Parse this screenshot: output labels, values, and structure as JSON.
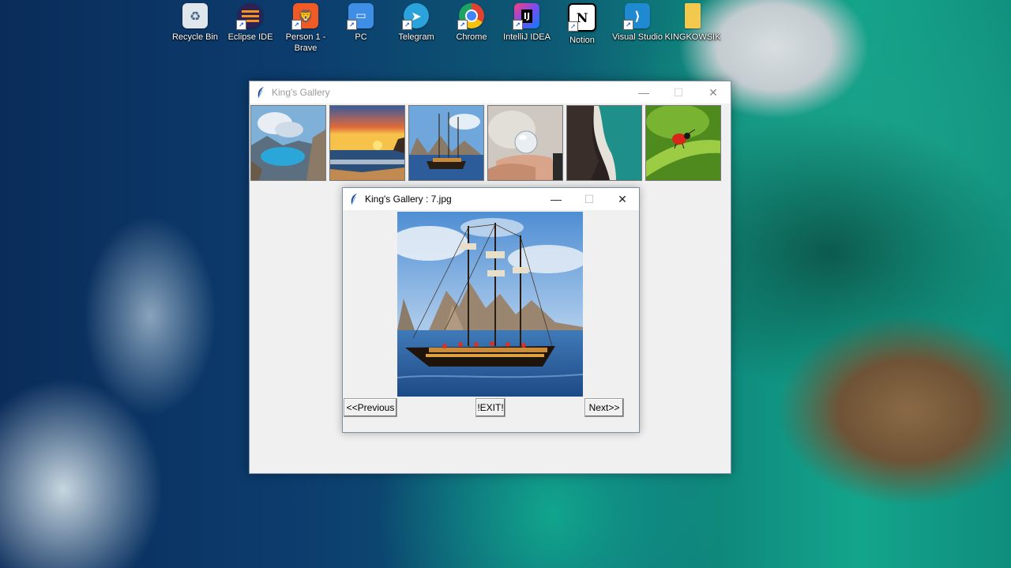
{
  "desktop": {
    "icons": [
      {
        "label": "Recycle Bin",
        "icon": "recycle-bin-icon",
        "color": "#d9e2ea"
      },
      {
        "label": "Eclipse IDE",
        "icon": "eclipse-icon",
        "color": "#3b2e74"
      },
      {
        "label": "Person 1 -\nBrave",
        "icon": "brave-icon",
        "color": "#f15a24"
      },
      {
        "label": "PC",
        "icon": "pc-icon",
        "color": "#3f8ee6"
      },
      {
        "label": "Telegram",
        "icon": "telegram-icon",
        "color": "#2aa3dd"
      },
      {
        "label": "Chrome",
        "icon": "chrome-icon",
        "color": "#e3412f"
      },
      {
        "label": "IntelliJ IDEA",
        "icon": "intellij-icon",
        "color": "#1e1e2e"
      },
      {
        "label": "Notion",
        "icon": "notion-icon",
        "color": "#ffffff"
      },
      {
        "label": "Visual Studio",
        "icon": "vscode-icon",
        "color": "#1f8ad2"
      },
      {
        "label": "KINGKOWSIK",
        "icon": "folder-icon",
        "color": "#f2c94c"
      }
    ]
  },
  "main_window": {
    "title": "King's Gallery",
    "controls": {
      "minimize": "—",
      "maximize": "☐",
      "close": "✕"
    },
    "thumbnails": [
      {
        "name": "mountain-lake-thumbnail"
      },
      {
        "name": "sunset-beach-thumbnail"
      },
      {
        "name": "pirate-ship-thumbnail"
      },
      {
        "name": "crystal-ball-hand-thumbnail"
      },
      {
        "name": "aerial-coast-thumbnail"
      },
      {
        "name": "ladybug-leaf-thumbnail"
      }
    ]
  },
  "child_window": {
    "title": "King's Gallery : 7.jpg",
    "controls": {
      "minimize": "—",
      "maximize": "☐",
      "close": "✕"
    },
    "image": "pirate-ship-photo",
    "buttons": {
      "previous": "<<Previous",
      "exit": "!EXIT!",
      "next": "Next>>"
    }
  }
}
